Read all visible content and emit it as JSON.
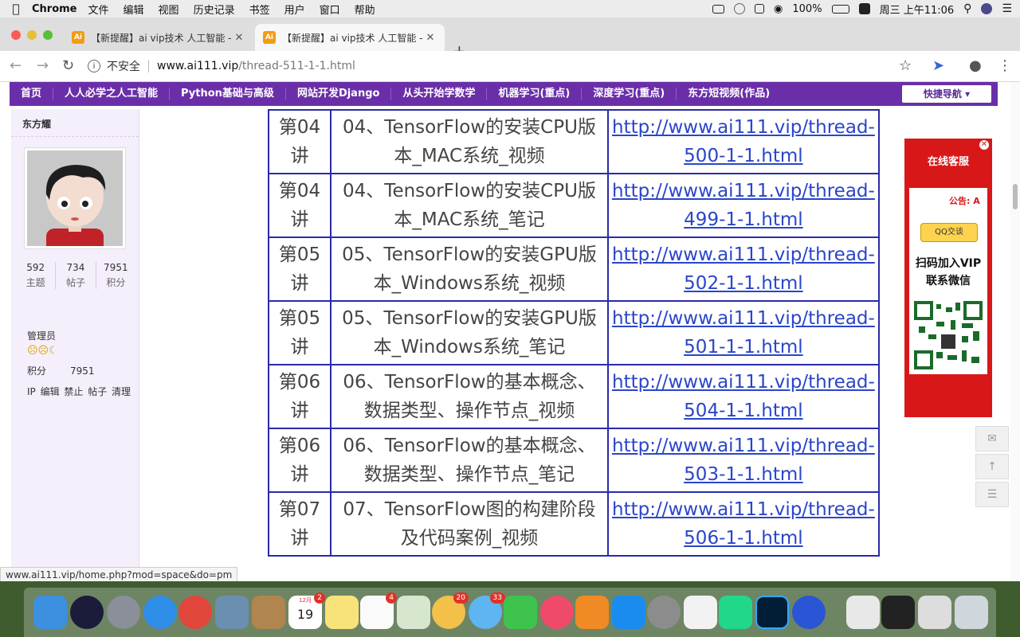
{
  "menubar": {
    "app": "Chrome",
    "items": [
      "文件",
      "编辑",
      "视图",
      "历史记录",
      "书签",
      "用户",
      "窗口",
      "帮助"
    ],
    "battery": "100%",
    "clock": "周三 上午11:06"
  },
  "tabs": [
    {
      "favicon": "Ai",
      "title": "【新提醒】ai vip技术 人工智能 -"
    },
    {
      "favicon": "Ai",
      "title": "【新提醒】ai vip技术 人工智能 -"
    }
  ],
  "address": {
    "security": "不安全",
    "host": "www.ai111.vip",
    "path": "/thread-511-1-1.html"
  },
  "sitenav": {
    "items": [
      "首页",
      "人人必学之人工智能",
      "Python基础与高级",
      "网站开发Django",
      "从头开始学数学",
      "机器学习(重点)",
      "深度学习(重点)",
      "东方短视频(作品)"
    ],
    "quick": "快捷导航"
  },
  "profile": {
    "name": "东方耀",
    "stats": [
      {
        "value": "592",
        "label": "主题"
      },
      {
        "value": "734",
        "label": "帖子"
      },
      {
        "value": "7951",
        "label": "积分"
      }
    ],
    "role": "管理员",
    "points_label": "积分",
    "points_value": "7951",
    "admin_links": "IP 编辑 禁止 帖子 清理"
  },
  "lessons": [
    {
      "num": "第04讲",
      "title": "04、TensorFlow的安装CPU版本_MAC系统_视频",
      "link": "http://www.ai111.vip/thread-500-1-1.html"
    },
    {
      "num": "第04讲",
      "title": "04、TensorFlow的安装CPU版本_MAC系统_笔记",
      "link": "http://www.ai111.vip/thread-499-1-1.html"
    },
    {
      "num": "第05讲",
      "title": "05、TensorFlow的安装GPU版本_Windows系统_视频",
      "link": "http://www.ai111.vip/thread-502-1-1.html"
    },
    {
      "num": "第05讲",
      "title": "05、TensorFlow的安装GPU版本_Windows系统_笔记",
      "link": "http://www.ai111.vip/thread-501-1-1.html"
    },
    {
      "num": "第06讲",
      "title": "06、TensorFlow的基本概念、数据类型、操作节点_视频",
      "link": "http://www.ai111.vip/thread-504-1-1.html"
    },
    {
      "num": "第06讲",
      "title": "06、TensorFlow的基本概念、数据类型、操作节点_笔记",
      "link": "http://www.ai111.vip/thread-503-1-1.html"
    },
    {
      "num": "第07讲",
      "title": "07、TensorFlow图的构建阶段及代码案例_视频",
      "link": "http://www.ai111.vip/thread-506-1-1.html"
    }
  ],
  "ad": {
    "header": "在线客服",
    "notice": "公告: A",
    "qq": "QQ交谈",
    "vip_line1": "扫码加入VIP",
    "vip_line2": "联系微信"
  },
  "status_url": "www.ai111.vip/home.php?mod=space&do=pm",
  "dock": {
    "calendar_day": "19",
    "calendar_month": "12月",
    "badges": {
      "calendar": "2",
      "reminders": "4",
      "photos": "20",
      "messages": "33"
    }
  }
}
